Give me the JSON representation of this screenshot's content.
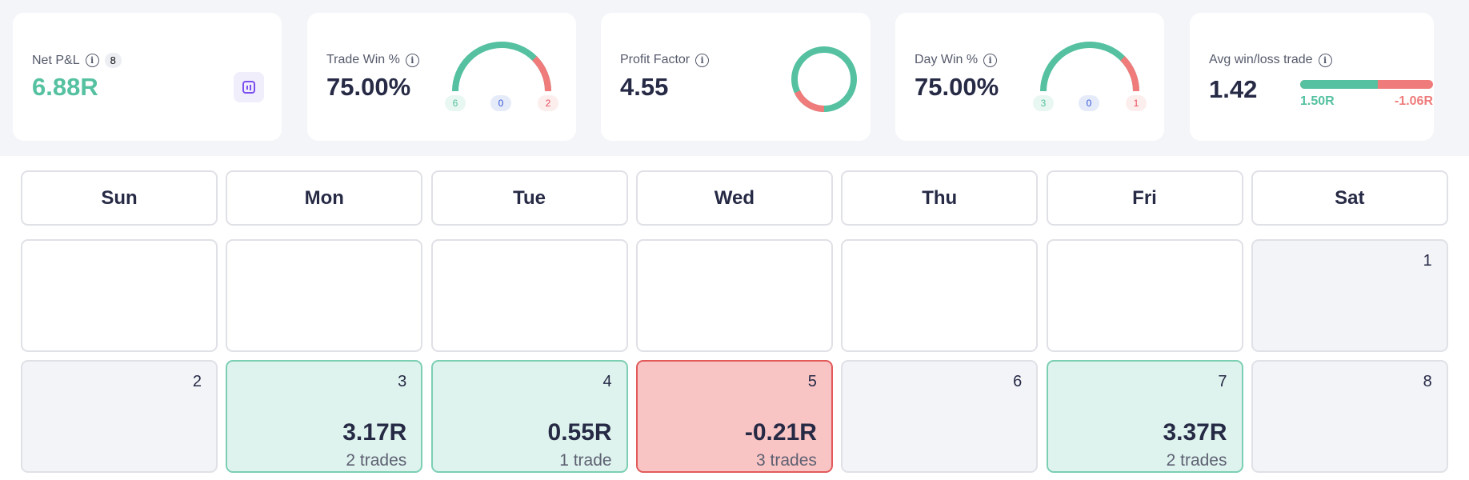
{
  "colors": {
    "green": "#55c1a0",
    "red": "#ef7b7b",
    "text": "#262a45"
  },
  "stats": {
    "net_pnl": {
      "label": "Net P&L",
      "count": "8",
      "value": "6.88R",
      "icon": "chart-icon"
    },
    "trade_win": {
      "label": "Trade Win %",
      "value": "75.00%",
      "wins": "6",
      "breakeven": "0",
      "losses": "2",
      "win_fraction": 0.75
    },
    "profit_factor": {
      "label": "Profit Factor",
      "value": "4.55",
      "win_fraction": 0.82
    },
    "day_win": {
      "label": "Day Win %",
      "value": "75.00%",
      "wins": "3",
      "breakeven": "0",
      "losses": "1",
      "win_fraction": 0.75
    },
    "avg_win_loss": {
      "label": "Avg win/loss trade",
      "value": "1.42",
      "avg_win": "1.50R",
      "avg_loss": "-1.06R",
      "win_fraction": 0.586
    }
  },
  "calendar": {
    "weekdays": [
      "Sun",
      "Mon",
      "Tue",
      "Wed",
      "Thu",
      "Fri",
      "Sat"
    ],
    "weeks": [
      [
        null,
        null,
        null,
        null,
        null,
        null,
        {
          "day": "1",
          "status": "gray"
        }
      ],
      [
        {
          "day": "2",
          "status": "gray"
        },
        {
          "day": "3",
          "status": "win",
          "pnl": "3.17R",
          "trades": "2 trades"
        },
        {
          "day": "4",
          "status": "win",
          "pnl": "0.55R",
          "trades": "1 trade"
        },
        {
          "day": "5",
          "status": "loss",
          "pnl": "-0.21R",
          "trades": "3 trades"
        },
        {
          "day": "6",
          "status": "gray"
        },
        {
          "day": "7",
          "status": "win",
          "pnl": "3.37R",
          "trades": "2 trades"
        },
        {
          "day": "8",
          "status": "gray"
        }
      ]
    ]
  }
}
